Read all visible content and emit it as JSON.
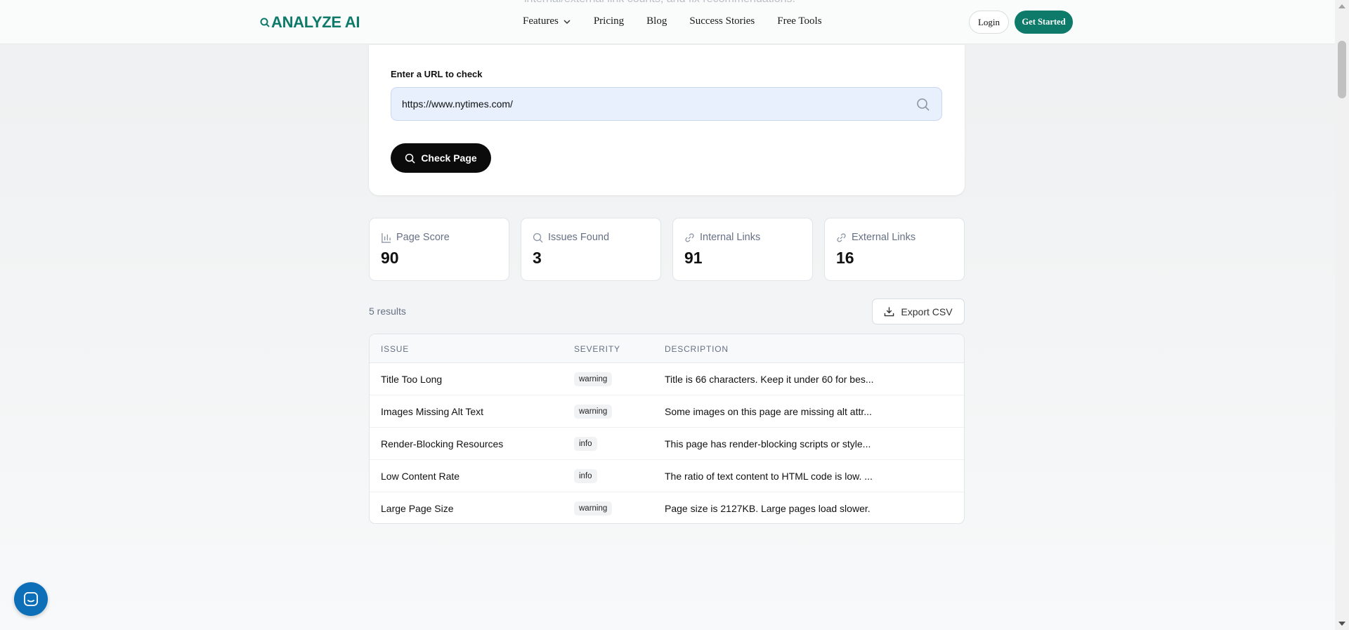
{
  "header": {
    "faded_text": "internal/external link counts, and fix recommendations.",
    "logo_text": "ANALYZE AI",
    "nav": [
      {
        "label": "Features",
        "has_dropdown": true
      },
      {
        "label": "Pricing"
      },
      {
        "label": "Blog"
      },
      {
        "label": "Success Stories"
      },
      {
        "label": "Free Tools"
      }
    ],
    "login_label": "Login",
    "get_started_label": "Get Started"
  },
  "url_checker": {
    "label": "Enter a URL to check",
    "url_value": "https://www.nytimes.com/",
    "check_button_label": "Check Page"
  },
  "stats": [
    {
      "label": "Page Score",
      "value": "90",
      "icon": "bar-chart-icon"
    },
    {
      "label": "Issues Found",
      "value": "3",
      "icon": "search-icon"
    },
    {
      "label": "Internal Links",
      "value": "91",
      "icon": "link-icon"
    },
    {
      "label": "External Links",
      "value": "16",
      "icon": "link-icon"
    }
  ],
  "results": {
    "count_text": "5 results",
    "export_label": "Export CSV"
  },
  "table": {
    "headers": [
      "ISSUE",
      "SEVERITY",
      "DESCRIPTION"
    ],
    "rows": [
      {
        "issue": "Title Too Long",
        "severity": "warning",
        "description": "Title is 66 characters. Keep it under 60 for bes..."
      },
      {
        "issue": "Images Missing Alt Text",
        "severity": "warning",
        "description": "Some images on this page are missing alt attr..."
      },
      {
        "issue": "Render-Blocking Resources",
        "severity": "info",
        "description": "This page has render-blocking scripts or style..."
      },
      {
        "issue": "Low Content Rate",
        "severity": "info",
        "description": "The ratio of text content to HTML code is low. ..."
      },
      {
        "issue": "Large Page Size",
        "severity": "warning",
        "description": "Page size is 2127KB. Large pages load slower."
      }
    ]
  },
  "colors": {
    "brand": "#0e7a6a",
    "button_dark": "#0b0b0b",
    "chat": "#0d6fb8"
  }
}
